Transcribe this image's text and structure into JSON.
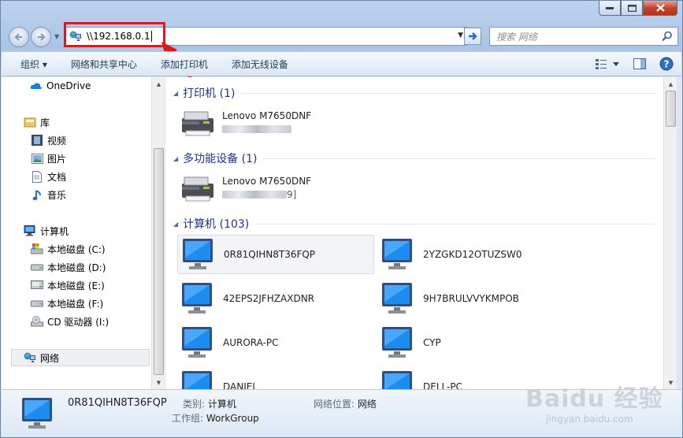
{
  "window": {
    "caption_buttons": [
      "minimize",
      "maximize",
      "close"
    ]
  },
  "nav": {
    "back_icon": "back-arrow-icon",
    "forward_icon": "forward-arrow-icon"
  },
  "address": {
    "value": "\\\\192.168.0.1",
    "icon": "network-icon"
  },
  "search": {
    "placeholder": "搜索 网络"
  },
  "toolbar": {
    "organize": "组织 ▾",
    "network_center": "网络和共享中心",
    "add_printer": "添加打印机",
    "add_wireless": "添加无线设备"
  },
  "sidebar": {
    "onedrive": "OneDrive",
    "libraries": "库",
    "videos": "视频",
    "pictures": "图片",
    "documents": "文档",
    "music": "音乐",
    "computer": "计算机",
    "drive_c": "本地磁盘 (C:)",
    "drive_d": "本地磁盘 (D:)",
    "drive_e": "本地磁盘 (E:)",
    "drive_f": "本地磁盘 (F:)",
    "drive_i": "CD 驱动器 (I:)",
    "network": "网络"
  },
  "groups": {
    "printers": "打印机 (1)",
    "multifunction": "多功能设备 (1)",
    "computers": "计算机 (103)"
  },
  "devices": {
    "printer_name": "Lenovo M7650DNF",
    "mfp_name": "Lenovo M7650DNF",
    "mfp_sub_tail": "9]"
  },
  "computers": [
    "0R81QIHN8T36FQP",
    "2YZGKD12OTUZSW0",
    "42EPS2JFHZAXDNR",
    "9H7BRULVVYKMPOB",
    "AURORA-PC",
    "CYP",
    "DANIEL",
    "DELL-PC"
  ],
  "details": {
    "name": "0R81QIHN8T36FQP",
    "category_label": "类别:",
    "category_value": "计算机",
    "location_label": "网络位置:",
    "location_value": "网络",
    "workgroup_label": "工作组:",
    "workgroup_value": "WorkGroup"
  },
  "watermark": {
    "main": "Baidu 经验",
    "sub": "jingyan.baidu.com"
  },
  "colors": {
    "highlight": "#e5151b",
    "group_title": "#1e3287",
    "toolbar_text": "#1e395b"
  }
}
